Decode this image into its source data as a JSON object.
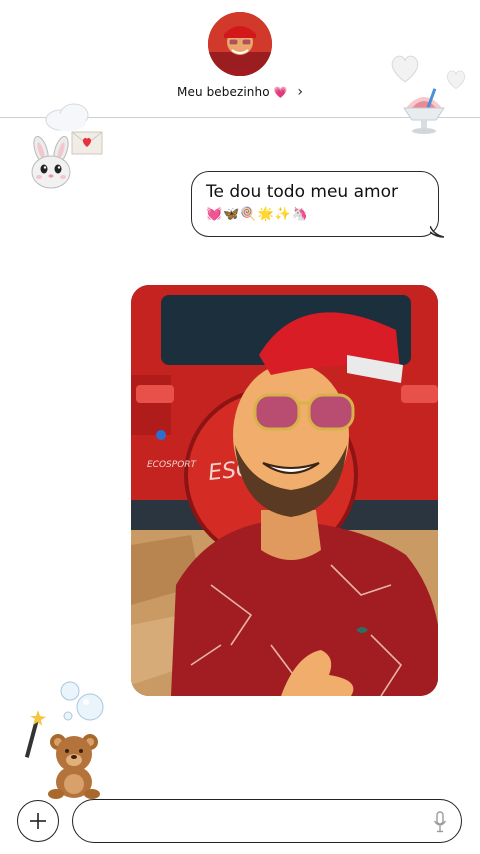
{
  "header": {
    "contact_name": "Meu bebezinho",
    "name_emoji": "💗",
    "chevron": "›"
  },
  "message": {
    "text": "Te dou todo meu amor",
    "emoji_line": "💓🦋🍭🌟✨🦄"
  },
  "composer": {
    "placeholder": "",
    "value": ""
  },
  "icons": {
    "add": "plus-icon",
    "mic": "microphone-icon"
  },
  "colors": {
    "accent_red": "#c8262b",
    "border": "#222222",
    "divider": "#cfcfcf"
  }
}
